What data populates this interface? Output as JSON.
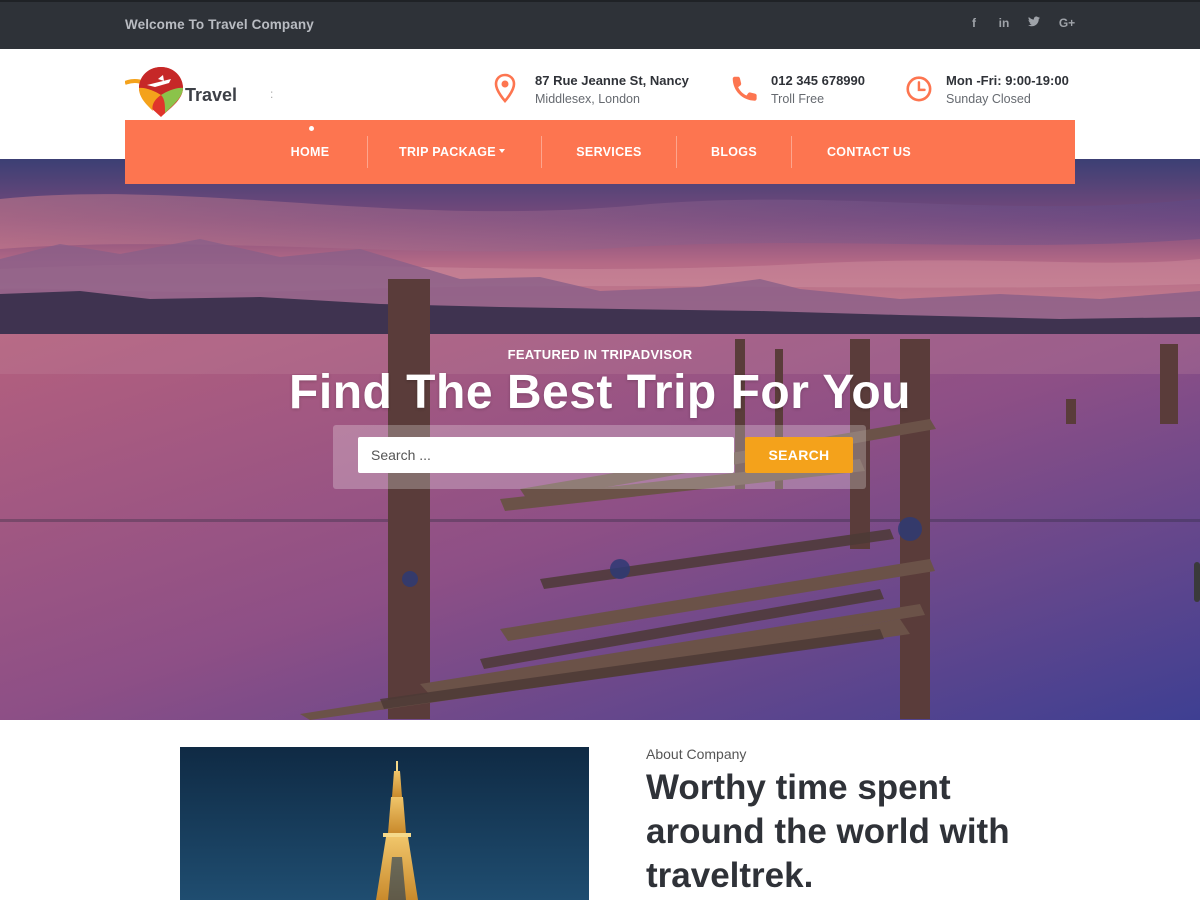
{
  "topbar": {
    "welcome": "Welcome To Travel Company",
    "social": [
      {
        "icon": "facebook-icon",
        "glyph": "f"
      },
      {
        "icon": "linkedin-icon",
        "glyph": "in"
      },
      {
        "icon": "twitter-icon",
        "glyph": "t"
      },
      {
        "icon": "google-plus-icon",
        "glyph": "G+"
      }
    ]
  },
  "header": {
    "logo_text": "Travel",
    "address": {
      "line1": "87 Rue Jeanne St, Nancy",
      "line2": "Middlesex, London"
    },
    "phone": {
      "line1": "012 345 678990",
      "line2": "Troll Free"
    },
    "hours": {
      "line1": "Mon -Fri: 9:00-19:00",
      "line2": "Sunday Closed"
    }
  },
  "nav": {
    "items": [
      {
        "label": "HOME"
      },
      {
        "label": "TRIP PACKAGE"
      },
      {
        "label": "SERVICES"
      },
      {
        "label": "BLOGS"
      },
      {
        "label": "CONTACT US"
      }
    ],
    "active": "HOME"
  },
  "hero": {
    "kicker": "FEATURED IN TRIPADVISOR",
    "title": "Find The Best Trip For You",
    "search": {
      "placeholder": "Search ...",
      "value": "",
      "button": "SEARCH"
    }
  },
  "about": {
    "kicker": "About Company",
    "title": "Worthy time spent around the world with traveltrek."
  },
  "colors": {
    "accent": "#fd7550",
    "search_button": "#f4a21b",
    "topbar": "#2e3238"
  }
}
